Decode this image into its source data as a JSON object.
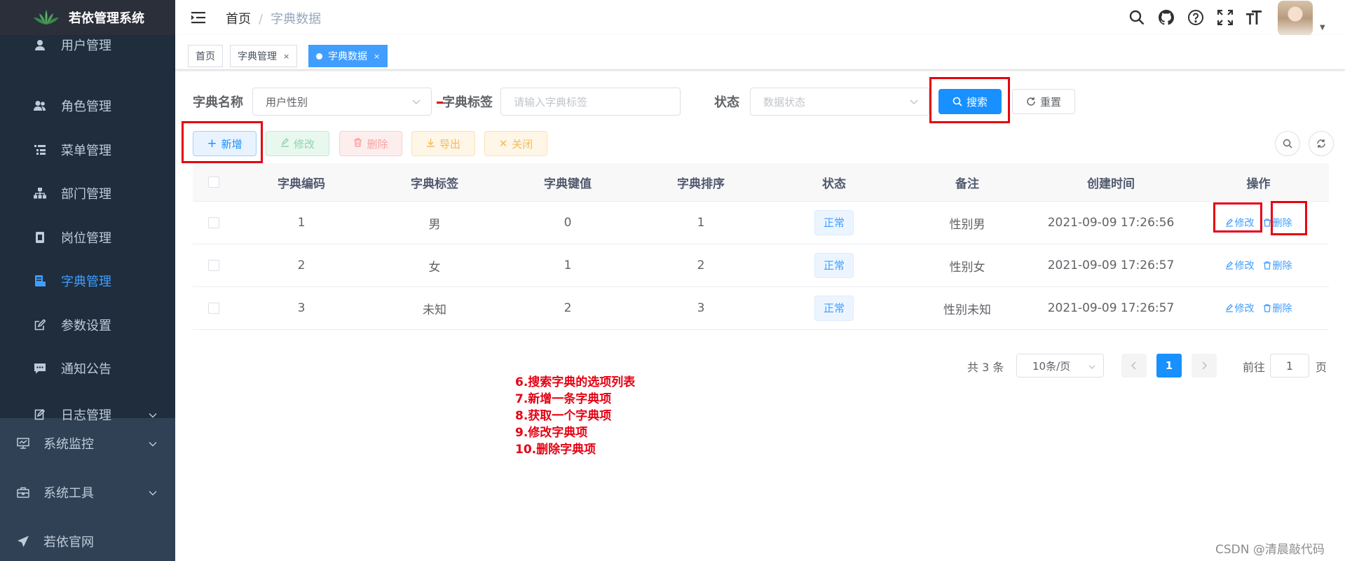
{
  "app": {
    "title": "若依管理系统"
  },
  "sidebar": {
    "items": [
      {
        "label": "用户管理",
        "icon": "user-icon"
      },
      {
        "label": "角色管理",
        "icon": "peoples-icon"
      },
      {
        "label": "菜单管理",
        "icon": "tree-table-icon"
      },
      {
        "label": "部门管理",
        "icon": "tree-icon"
      },
      {
        "label": "岗位管理",
        "icon": "post-icon"
      },
      {
        "label": "字典管理",
        "icon": "dict-icon",
        "active": true
      },
      {
        "label": "参数设置",
        "icon": "edit-icon"
      },
      {
        "label": "通知公告",
        "icon": "message-icon"
      },
      {
        "label": "日志管理",
        "icon": "log-icon"
      }
    ],
    "top_items": [
      {
        "label": "系统监控",
        "icon": "monitor-icon"
      },
      {
        "label": "系统工具",
        "icon": "tool-icon"
      },
      {
        "label": "若依官网",
        "icon": "guide-icon"
      }
    ]
  },
  "header": {
    "breadcrumb": {
      "home": "首页",
      "separator": "/",
      "current": "字典数据"
    }
  },
  "tags": [
    {
      "label": "首页"
    },
    {
      "label": "字典管理",
      "close": "×"
    },
    {
      "label": "字典数据",
      "close": "×",
      "active": true
    }
  ],
  "search": {
    "dict_name_label": "字典名称",
    "dict_name_value": "用户性别",
    "dict_label_label": "字典标签",
    "dict_label_placeholder": "请输入字典标签",
    "status_label": "状态",
    "status_placeholder": "数据状态",
    "search_button": "搜索",
    "reset_button": "重置"
  },
  "toolbar": {
    "add": "新增",
    "edit": "修改",
    "delete": "删除",
    "export": "导出",
    "close": "关闭"
  },
  "table": {
    "columns": [
      "字典编码",
      "字典标签",
      "字典键值",
      "字典排序",
      "状态",
      "备注",
      "创建时间",
      "操作"
    ],
    "rows": [
      {
        "code": "1",
        "label": "男",
        "value": "0",
        "sort": "1",
        "status": "正常",
        "remark": "性别男",
        "created": "2021-09-09 17:26:56"
      },
      {
        "code": "2",
        "label": "女",
        "value": "1",
        "sort": "2",
        "status": "正常",
        "remark": "性别女",
        "created": "2021-09-09 17:26:57"
      },
      {
        "code": "3",
        "label": "未知",
        "value": "2",
        "sort": "3",
        "status": "正常",
        "remark": "性别未知",
        "created": "2021-09-09 17:26:57"
      }
    ],
    "row_edit": "修改",
    "row_delete": "删除"
  },
  "pagination": {
    "total": "共 3 条",
    "page_size": "10条/页",
    "current_page": "1",
    "goto_prefix": "前往",
    "goto_value": "1",
    "goto_suffix": "页"
  },
  "notes": [
    "6.搜索字典的选项列表",
    "7.新增一条字典项",
    "8.获取一个字典项",
    "9.修改字典项",
    "10.删除字典项"
  ],
  "watermark": "CSDN @清晨敲代码",
  "colors": {
    "primary": "#1890ff",
    "sidebar_bg": "#304156",
    "submenu_bg": "#1f2d3d",
    "annotation": "#e60012"
  }
}
